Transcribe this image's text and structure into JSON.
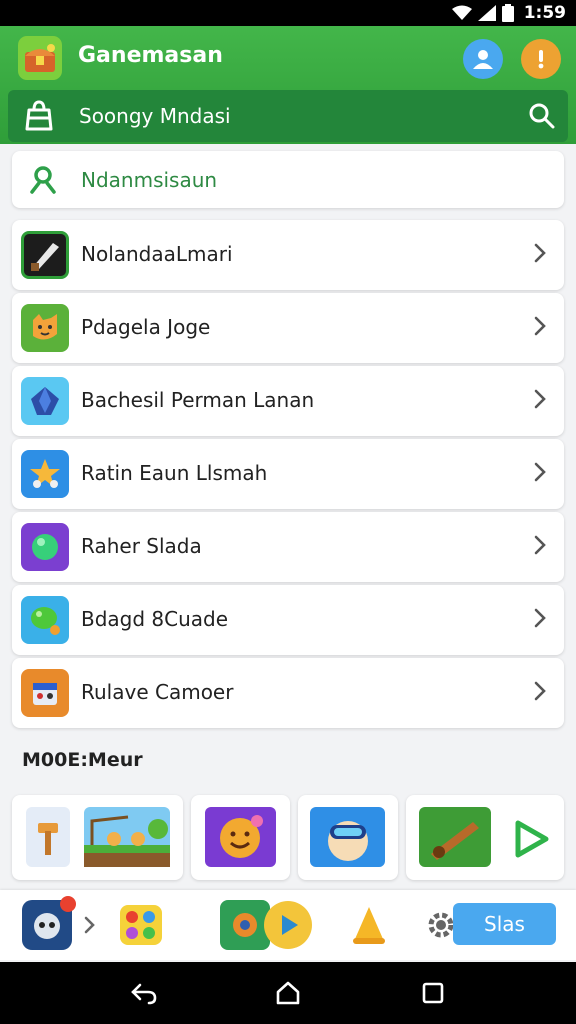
{
  "status_bar": {
    "time": "1:59"
  },
  "header": {
    "title": "Ganemasan",
    "search": {
      "text": "Soongy Mndasi"
    }
  },
  "filter": {
    "label": "Ndanmsisaun"
  },
  "list": {
    "items": [
      {
        "label": "NolandaaLmari",
        "icon": "knife-icon",
        "color": "#2f9e39"
      },
      {
        "label": "Pdagela Joge",
        "icon": "cat-icon",
        "color": "#5bb13a"
      },
      {
        "label": "Bachesil Perman Lanan",
        "icon": "gem-icon",
        "color": "#5ac8f2"
      },
      {
        "label": "Ratin Eaun Llsmah",
        "icon": "star-character-icon",
        "color": "#2e8fe5"
      },
      {
        "label": "Raher Slada",
        "icon": "orb-icon",
        "color": "#7b3fd0"
      },
      {
        "label": "Bdagd 8Cuade",
        "icon": "bubble-icon",
        "color": "#3ab0e8"
      },
      {
        "label": "Rulave Camoer",
        "icon": "robot-icon",
        "color": "#e88a2b"
      }
    ]
  },
  "section": {
    "title": "M00E:Meur"
  },
  "showcase": {
    "tiles": [
      {
        "icon": "hammer-icon"
      },
      {
        "icon": "farm-scene-icon"
      },
      {
        "icon": "smiley-icon"
      },
      {
        "icon": "diver-icon"
      },
      {
        "icon": "cannon-icon"
      }
    ]
  },
  "bottom_bar": {
    "play_label": "Slas",
    "apps": [
      "alien-app-icon",
      "candy-app-icon",
      "gear-game-icon",
      "play-icon",
      "bell-icon",
      "settings-icon"
    ]
  },
  "colors": {
    "brand_green": "#3aaa47",
    "dark_green": "#23863a",
    "accent_blue": "#4aa8ef",
    "accent_orange": "#eda232"
  }
}
